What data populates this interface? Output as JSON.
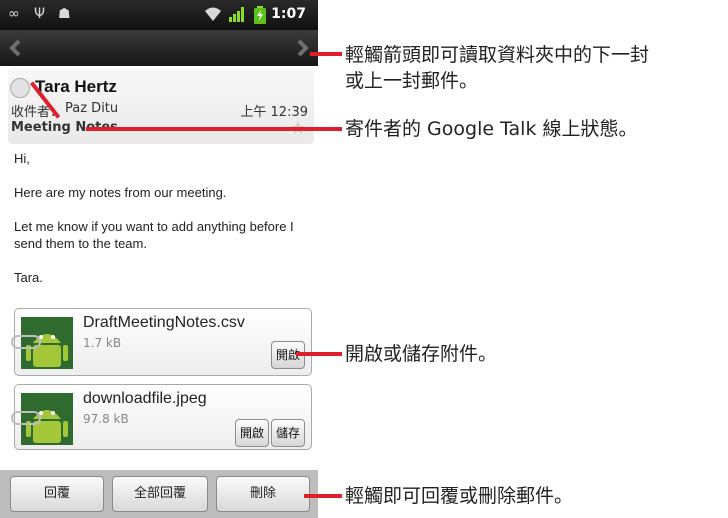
{
  "status_bar": {
    "icons": [
      "voicemail-icon",
      "usb-icon",
      "debug-icon",
      "wifi-icon",
      "signal-icon",
      "battery-icon"
    ],
    "time": "1:07"
  },
  "nav": {
    "prev_icon": "arrow-left-icon",
    "next_icon": "arrow-right-icon"
  },
  "message": {
    "sender": "Tara Hertz",
    "to_label": "收件者：",
    "to_name": "Paz Ditu",
    "time": "上午 12:39",
    "subject": "Meeting Notes",
    "body": [
      "Hi,",
      "Here are my notes from our meeting.",
      "Let me know if you want to add anything before I send them to the team.",
      "Tara."
    ]
  },
  "attachments": [
    {
      "name": "DraftMeetingNotes.csv",
      "size": "1.7 kB",
      "open_label": "開啟"
    },
    {
      "name": "downloadfile.jpeg",
      "size": "97.8 kB",
      "open_label": "開啟",
      "save_label": "儲存"
    }
  ],
  "actions": {
    "reply": "回覆",
    "reply_all": "全部回覆",
    "delete": "刪除"
  },
  "callouts": {
    "arrows_line1": "輕觸箭頭即可讀取資料夾中的下一封",
    "arrows_line2": "或上一封郵件。",
    "presence": "寄件者的 Google Talk 線上狀態。",
    "attachment": "開啟或儲存附件。",
    "actions": "輕觸即可回覆或刪除郵件。"
  },
  "colors": {
    "callout": "#e01f2d",
    "android_green": "#a4c639"
  }
}
